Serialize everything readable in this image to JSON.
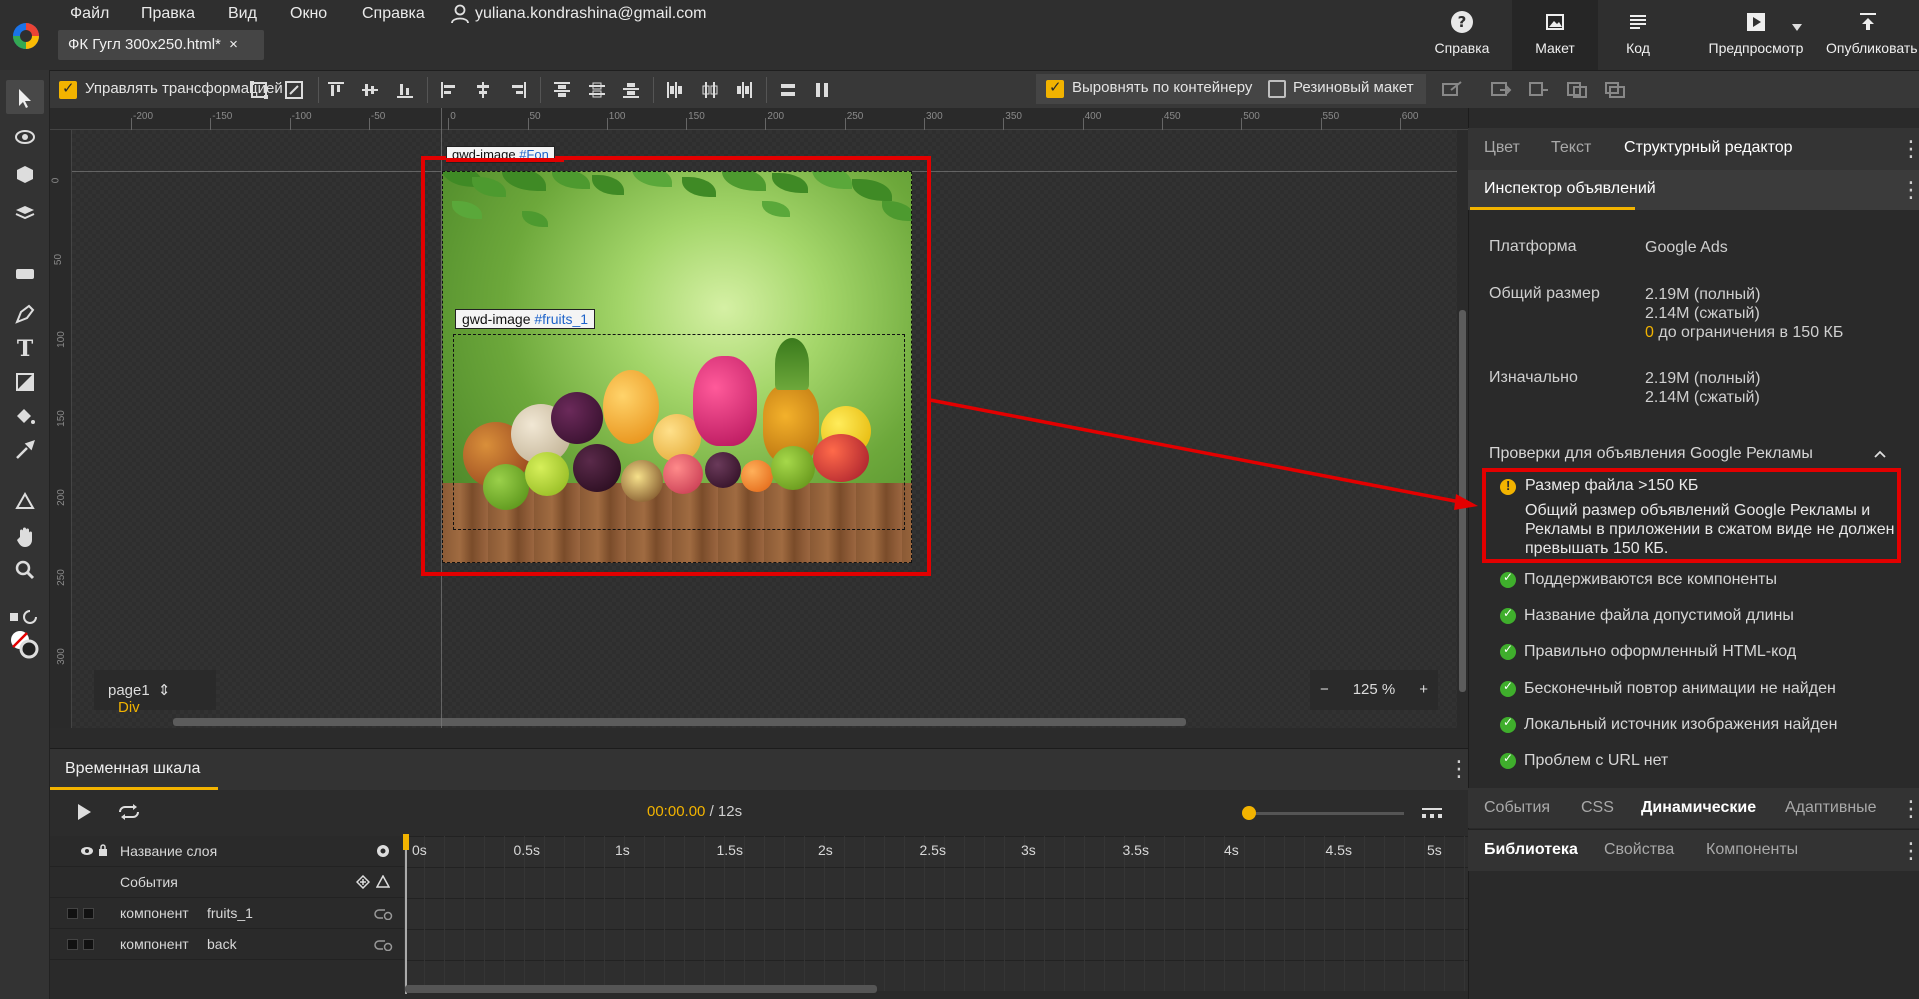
{
  "menu": {
    "file": "Файл",
    "edit": "Правка",
    "view": "Вид",
    "window": "Окно",
    "help": "Справка",
    "account": "yuliana.kondrashina@gmail.com"
  },
  "doc_tab": "ФК Гугл 300x250.html*",
  "doc_tab_close": "×",
  "top_buttons": {
    "help": "Справка",
    "layout": "Макет",
    "code": "Код",
    "preview": "Предпросмотр",
    "publish": "Опубликовать"
  },
  "toolbar": {
    "manage_transform": "Управлять трансформацией",
    "fit_container": "Выровнять по контейнеру",
    "rubber_layout": "Резиновый макет"
  },
  "ruler": {
    "h_ticks": [
      "-200",
      "-150",
      "-100",
      "-50",
      "0",
      "50",
      "100",
      "150",
      "200",
      "250",
      "300",
      "350",
      "400",
      "450",
      "500",
      "550",
      "600"
    ],
    "v_ticks": [
      "0",
      "50",
      "100",
      "150",
      "200",
      "250",
      "300"
    ]
  },
  "stage": {
    "tag_fon": {
      "prefix": "gwd-image ",
      "id": "#Fon"
    },
    "tag_fruits": {
      "prefix": "gwd-image ",
      "id": "#fruits_1"
    },
    "page": "page1",
    "page_arrows": "⇕",
    "element_type": "Div",
    "zoom_minus": "−",
    "zoom_value": "125",
    "zoom_unit": "%",
    "zoom_plus": "+"
  },
  "timeline": {
    "tab": "Временная шкала",
    "current_time": "00:00.00",
    "total_time": "/ 12s",
    "layer_name_header": "Название слоя",
    "events_row": "События",
    "ticks": [
      "0s",
      "0.5s",
      "1s",
      "1.5s",
      "2s",
      "2.5s",
      "3s",
      "3.5s",
      "4s",
      "4.5s",
      "5s"
    ],
    "rows": [
      {
        "type": "компонент",
        "name": "fruits_1"
      },
      {
        "type": "компонент",
        "name": "back"
      }
    ]
  },
  "right_panel": {
    "tabs": [
      "Цвет",
      "Текст",
      "Структурный редактор"
    ],
    "inspector_title": "Инспектор объявлений",
    "platform_label": "Платформа",
    "platform_value": "Google Ads",
    "total_size_label": "Общий размер",
    "total_full": "2.19M (полный)",
    "total_compressed": "2.14M (сжатый)",
    "limit_zero": "0",
    "limit_text": " до ограничения в 150 КБ",
    "initial_label": "Изначально",
    "initial_full": "2.19M (полный)",
    "initial_compressed": "2.14M (сжатый)",
    "checks_header": "Проверки для объявления Google Рекламы",
    "warning_title": "Размер файла >150 КБ",
    "warning_text": "Общий размер объявлений Google Рекламы и Рекламы в приложении в сжатом виде не должен превышать 150 КБ.",
    "checks": [
      "Поддерживаются все компоненты",
      "Название файла допустимой длины",
      "Правильно оформленный HTML-код",
      "Бесконечный повтор анимации не найден",
      "Локальный источник изображения найден",
      "Проблем с URL нет"
    ],
    "bottom_tabs_1": [
      "События",
      "CSS",
      "Динамические",
      "Адаптивные"
    ],
    "bottom_tabs_2": [
      "Библиотека",
      "Свойства",
      "Компоненты"
    ]
  },
  "colors": {
    "accent": "#f2b300",
    "highlight_red": "#e30000",
    "ok_green": "#3fae2c",
    "id_blue": "#1e63c9"
  },
  "icons": [
    "select-icon",
    "3d-rotate-icon",
    "3d-object-icon",
    "3d-translate-icon",
    "tag-icon",
    "pen-icon",
    "text-icon",
    "shape-icon",
    "paint-bucket-icon",
    "eyedropper-icon",
    "3d-stage-icon",
    "hand-icon",
    "zoom-icon"
  ]
}
